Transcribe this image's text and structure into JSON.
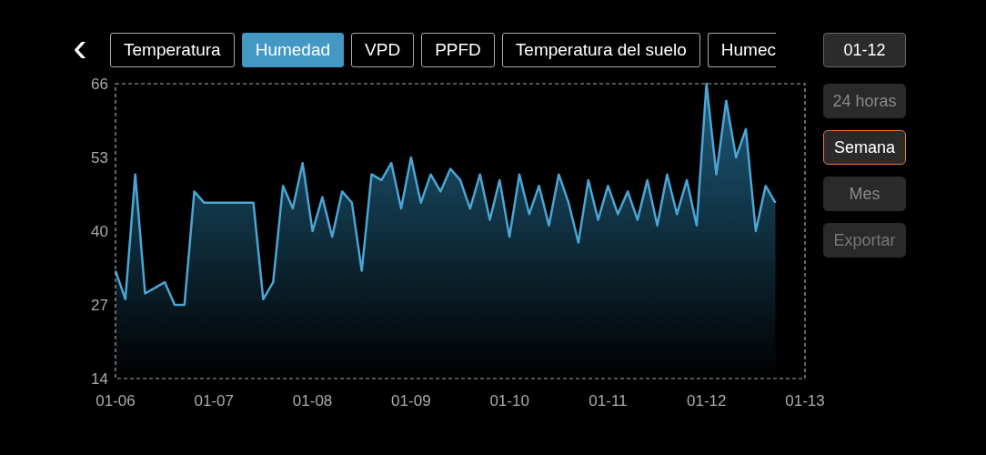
{
  "back_button": {
    "label": "‹"
  },
  "tabs": [
    {
      "label": "Temperatura",
      "selected": false,
      "clipped": false
    },
    {
      "label": "Humedad",
      "selected": true,
      "clipped": false
    },
    {
      "label": "VPD",
      "selected": false,
      "clipped": false
    },
    {
      "label": "PPFD",
      "selected": false,
      "clipped": false
    },
    {
      "label": "Temperatura del suelo",
      "selected": false,
      "clipped": false
    },
    {
      "label": "Humec",
      "selected": false,
      "clipped": true
    }
  ],
  "date_button": {
    "label": "01-12"
  },
  "range_buttons": [
    {
      "label": "24 horas",
      "selected": false
    },
    {
      "label": "Semana",
      "selected": true
    },
    {
      "label": "Mes",
      "selected": false
    }
  ],
  "export_button": {
    "label": "Exportar",
    "disabled": true
  },
  "chart": {
    "chart_data": {
      "type": "area",
      "ylim": [
        14,
        66
      ],
      "yticks": [
        14,
        27,
        40,
        53,
        66
      ],
      "categories": [
        "01-06",
        null,
        null,
        null,
        null,
        null,
        null,
        null,
        null,
        null,
        "01-07",
        null,
        null,
        null,
        null,
        null,
        null,
        null,
        null,
        null,
        "01-08",
        null,
        null,
        null,
        null,
        null,
        null,
        null,
        null,
        null,
        "01-09",
        null,
        null,
        null,
        null,
        null,
        null,
        null,
        null,
        null,
        "01-10",
        null,
        null,
        null,
        null,
        null,
        null,
        null,
        null,
        null,
        "01-11",
        null,
        null,
        null,
        null,
        null,
        null,
        null,
        null,
        null,
        "01-12",
        null,
        null,
        null,
        null,
        null,
        null,
        null,
        null,
        null,
        "01-13"
      ],
      "series": [
        {
          "color": "#4aa6d4",
          "values": [
            33,
            28,
            50,
            29,
            30,
            31,
            27,
            27,
            47,
            45,
            45,
            45,
            45,
            45,
            45,
            28,
            31,
            48,
            44,
            52,
            40,
            46,
            39,
            47,
            45,
            33,
            50,
            49,
            52,
            44,
            53,
            45,
            50,
            47,
            51,
            49,
            44,
            50,
            42,
            49,
            39,
            50,
            43,
            48,
            41,
            50,
            45,
            38,
            49,
            42,
            48,
            43,
            47,
            42,
            49,
            41,
            50,
            43,
            49,
            41,
            66,
            50,
            63,
            53,
            58,
            40,
            48,
            45,
            null,
            null,
            null
          ]
        }
      ]
    }
  }
}
